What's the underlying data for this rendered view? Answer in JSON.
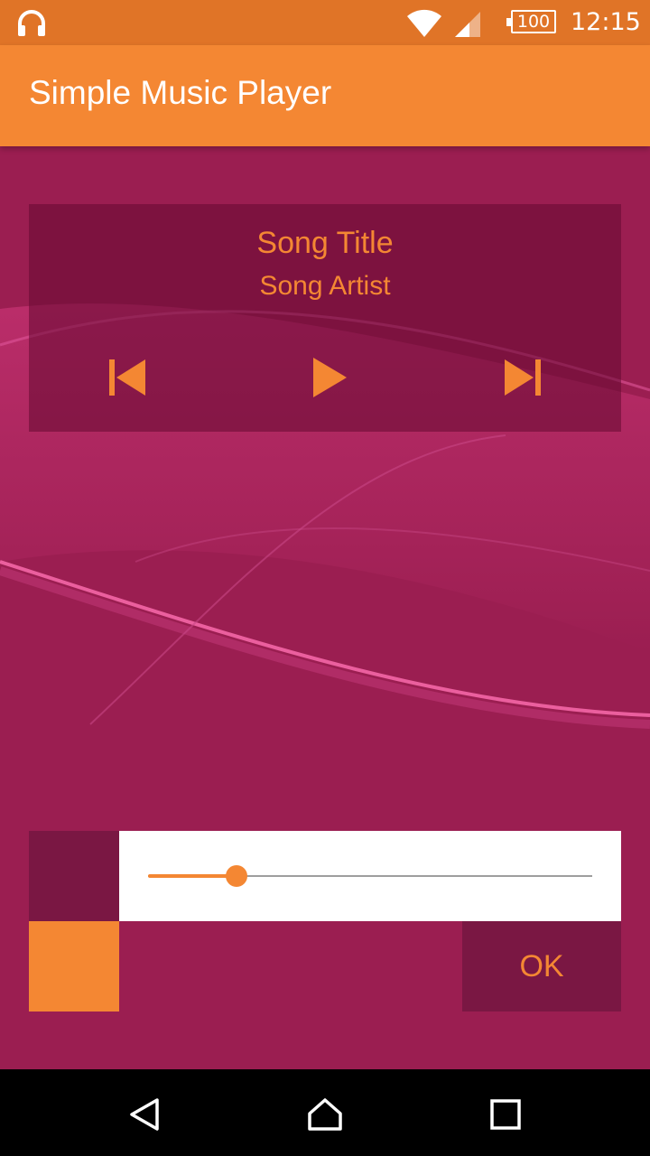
{
  "status_bar": {
    "battery": "100",
    "time": "12:15",
    "icons": [
      "headphones-icon",
      "wifi-icon",
      "cell-signal-icon",
      "battery-icon"
    ]
  },
  "app_bar": {
    "title": "Simple Music Player"
  },
  "player": {
    "song_title": "Song Title",
    "song_artist": "Song Artist",
    "controls": [
      "skip-previous-icon",
      "play-icon",
      "skip-next-icon"
    ]
  },
  "seek": {
    "progress": 0.2
  },
  "actions": {
    "ok_label": "OK"
  },
  "navigation": {
    "icons": [
      "back-icon",
      "home-icon",
      "recents-icon"
    ]
  },
  "colors": {
    "status_bar": "#e07427",
    "accent": "#f48733",
    "background": "#9b1e51",
    "panel_dark": "#7a1743"
  }
}
